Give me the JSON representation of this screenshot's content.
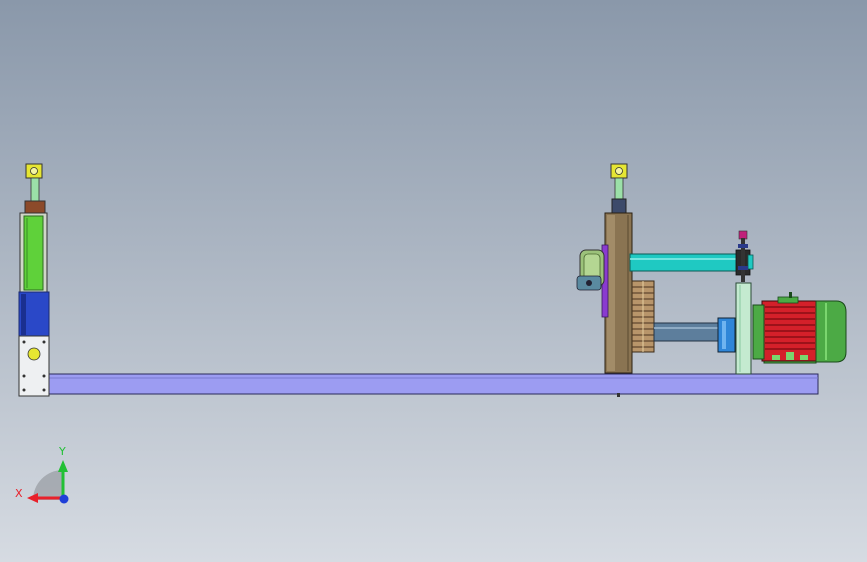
{
  "viewport": {
    "background_top": "#8a98aa",
    "background_bottom": "#d6dbe2"
  },
  "triad": {
    "x_label": "X",
    "y_label": "Y",
    "x_color": "#e8202a",
    "y_color": "#22c035",
    "z_color": "#1f3fd8"
  },
  "colors": {
    "base_beam": "#9c9cf2",
    "left_column_block": "#2a48c8",
    "left_column_green": "#5fd13a",
    "gearbox_brown": "#8a7452",
    "shaft_cyan": "#1fc9c2",
    "shaft_steel": "#5d7e9c",
    "motor_red": "#d4202a",
    "motor_green": "#4caa45",
    "pivot_yellow": "#e6e632"
  }
}
